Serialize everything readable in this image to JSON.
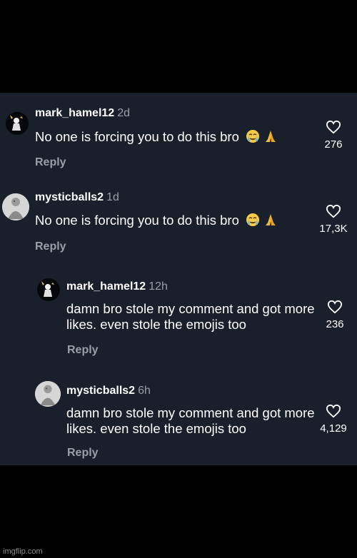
{
  "comments": [
    {
      "username": "mark_hamel12",
      "time": "2d",
      "text": "No one is forcing you to do this bro",
      "emojis": [
        "crying-face-icon",
        "folded-hands-icon"
      ],
      "likes": "276",
      "reply_label": "Reply",
      "avatar": "black-figure-avatar"
    },
    {
      "username": "mysticballs2",
      "time": "1d",
      "text": "No one is forcing you to do this bro",
      "emojis": [
        "crying-face-icon",
        "folded-hands-icon"
      ],
      "likes": "17,3K",
      "reply_label": "Reply",
      "avatar": "white-statue-avatar"
    },
    {
      "username": "mark_hamel12",
      "time": "12h",
      "text": "damn bro stole my comment and got more likes. even stole the emojis too",
      "likes": "236",
      "reply_label": "Reply",
      "avatar": "black-figure-avatar"
    },
    {
      "username": "mysticballs2",
      "time": "6h",
      "text": "damn bro stole my comment and got more likes. even stole the emojis too",
      "likes": "4,129",
      "reply_label": "Reply",
      "avatar": "white-statue-avatar"
    }
  ],
  "watermark": "imgflip.com",
  "colors": {
    "background": "#000000",
    "panel": "#1a1f2c",
    "text": "#ffffff",
    "muted": "#9a9ea8"
  }
}
